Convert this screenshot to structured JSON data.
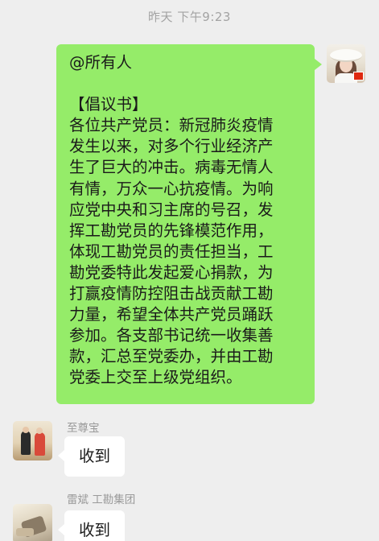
{
  "timestamp": "昨天 下午9:23",
  "outgoing_message": {
    "text_lines": [
      "@所有人",
      "",
      "【倡议书】",
      "各位共产党员：新冠肺炎疫情",
      "发生以来，对多个行业经济产",
      "生了巨大的冲击。病毒无情人",
      "有情，万众一心抗疫情。为响",
      "应党中央和习主席的号召，发",
      "挥工勘党员的先锋模范作用，",
      "体现工勘党员的责任担当，工",
      "勘党委特此发起爱心捐款，为",
      "打赢疫情防控阻击战贡献工勘",
      "力量，希望全体共产党员踊跃",
      "参加。各支部书记统一收集善",
      "款，汇总至党委办，并由工勘",
      "党委上交至上级党组织。"
    ],
    "bubble_color": "#95ec69",
    "avatar_icon": "user-avatar-self"
  },
  "incoming_messages": [
    {
      "sender": "至尊宝",
      "text": "收到",
      "avatar_icon": "user-avatar-zhizunbao"
    },
    {
      "sender": "雷斌 工勘集团",
      "text": "收到",
      "avatar_icon": "user-avatar-leibin"
    }
  ],
  "colors": {
    "background": "#eeeeee",
    "incoming_bubble": "#ffffff",
    "timestamp_text": "#a3a3a3",
    "sender_text": "#9a9a9a"
  }
}
